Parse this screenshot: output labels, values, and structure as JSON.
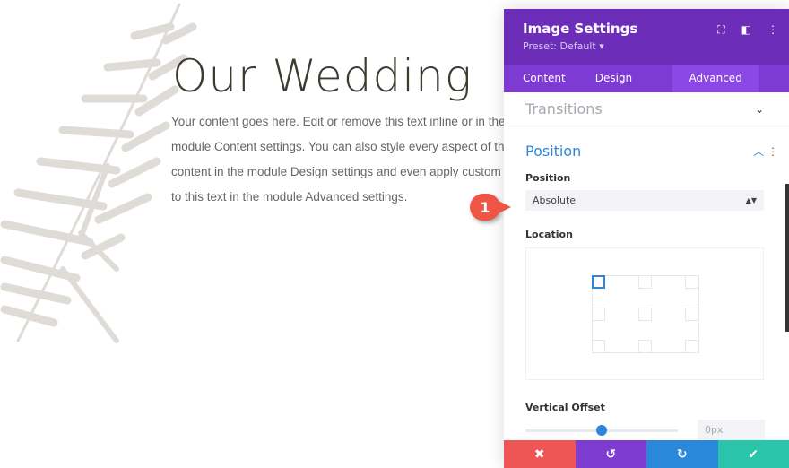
{
  "page": {
    "title": "Our Wedding",
    "body_lines": [
      "Your content goes here. Edit or remove this text inline or in the",
      "module Content settings. You can also style every aspect of this",
      "content in the module Design settings and even apply custom",
      "to this text in the module Advanced settings."
    ]
  },
  "panel": {
    "title": "Image Settings",
    "preset": "Preset: Default ▾",
    "tabs": [
      "Content",
      "Design",
      "Advanced"
    ],
    "active_tab": "Advanced",
    "transitions_label": "Transitions",
    "position_section": "Position",
    "position_label": "Position",
    "position_value": "Absolute",
    "location_label": "Location",
    "location_selected": "top-left",
    "vertical_offset_label": "Vertical Offset",
    "vertical_offset_value": "0px",
    "vertical_offset_slider_percent": 50
  },
  "annotation": {
    "number": "1"
  },
  "colors": {
    "header": "#6c2eb9",
    "accent": "#2b87da",
    "cancel": "#ef5555",
    "undo": "#7e3bd0",
    "redo": "#2b87da",
    "save": "#29c4a9"
  }
}
